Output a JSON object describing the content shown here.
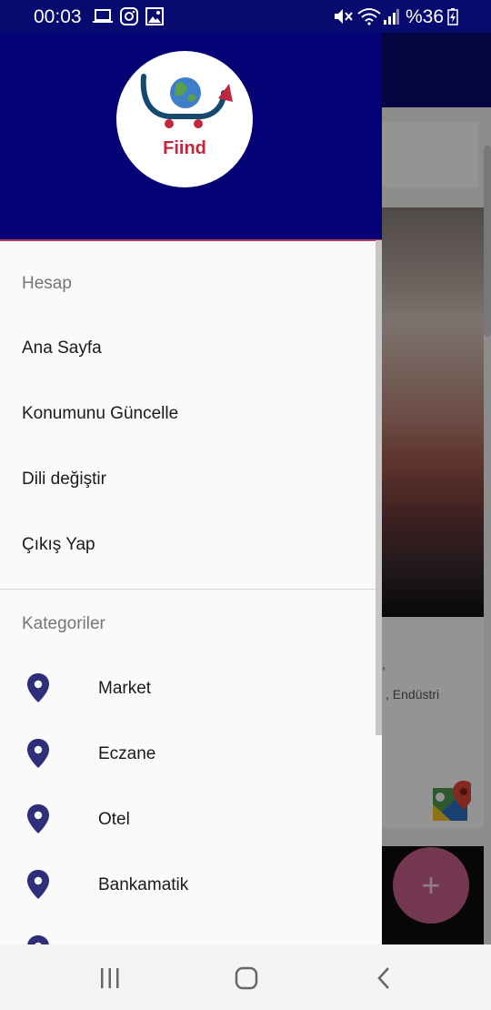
{
  "status_bar": {
    "time": "00:03",
    "battery": "%36",
    "icons": [
      "laptop-icon",
      "instagram-icon",
      "image-icon",
      "mute-icon",
      "wifi-icon",
      "signal-icon",
      "battery-charging-icon"
    ]
  },
  "drawer": {
    "logo_text": "Fiind",
    "account_section": "Hesap",
    "account_items": [
      "Ana Sayfa",
      "Konumunu Güncelle",
      "Dili değiştir",
      "Çıkış Yap"
    ],
    "category_section": "Kategoriler",
    "category_items": [
      "Market",
      "Eczane",
      "Otel",
      "Bankamatik"
    ]
  },
  "background_app": {
    "card_text": ", Endüstri",
    "card_text_prefix": ","
  },
  "colors": {
    "header": "#030375",
    "accent": "#2e2e7a",
    "fab": "#c9608a"
  }
}
